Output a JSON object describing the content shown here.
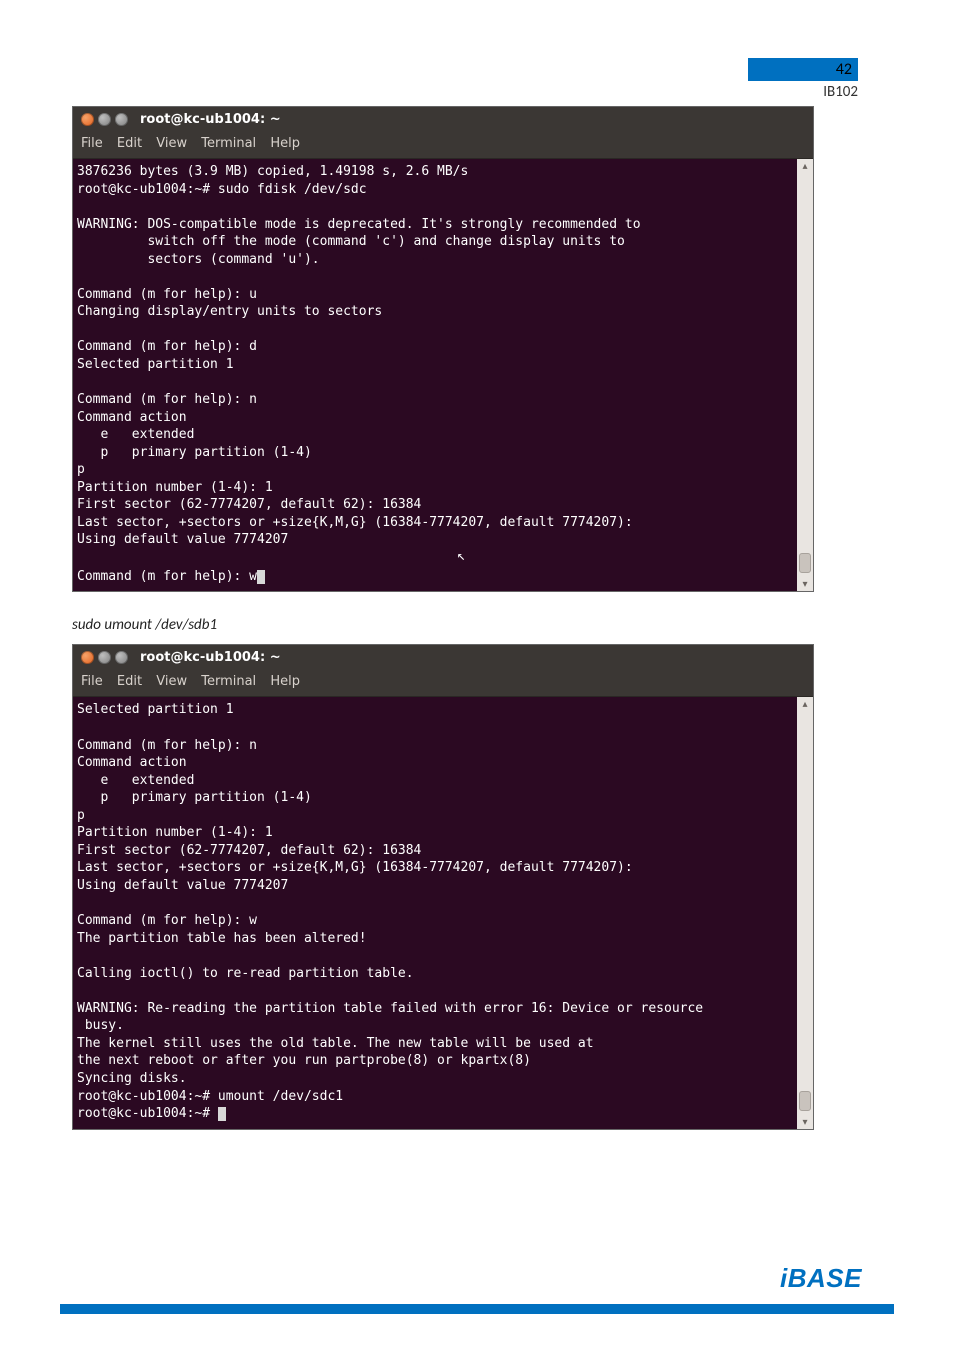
{
  "header": {
    "page_number": "42",
    "model": "IB102"
  },
  "terminal1": {
    "title": "root@kc-ub1004: ~",
    "menu": [
      "File",
      "Edit",
      "View",
      "Terminal",
      "Help"
    ],
    "lines_pre": "3876236 bytes (3.9 MB) copied, 1.49198 s, 2.6 MB/s\nroot@kc-ub1004:~# sudo fdisk /dev/sdc\n\nWARNING: DOS-compatible mode is deprecated. It's strongly recommended to\n         switch off the mode (command 'c') and change display units to\n         sectors (command 'u').\n\nCommand (m for help): u\nChanging display/entry units to sectors\n\nCommand (m for help): d\nSelected partition 1\n\nCommand (m for help): n\nCommand action\n   e   extended\n   p   primary partition (1-4)\np\nPartition number (1-4): 1\nFirst sector (62-7774207, default 62): 16384\nLast sector, +sectors or +size{K,M,G} (16384-7774207, default 7774207):\nUsing default value 7774207",
    "last_line": "Command (m for help): w"
  },
  "caption": "sudo umount /dev/sdb1",
  "terminal2": {
    "title": "root@kc-ub1004: ~",
    "menu": [
      "File",
      "Edit",
      "View",
      "Terminal",
      "Help"
    ],
    "lines_pre": "Selected partition 1\n\nCommand (m for help): n\nCommand action\n   e   extended\n   p   primary partition (1-4)\np\nPartition number (1-4): 1\nFirst sector (62-7774207, default 62): 16384\nLast sector, +sectors or +size{K,M,G} (16384-7774207, default 7774207):\nUsing default value 7774207\n\nCommand (m for help): w\nThe partition table has been altered!\n\nCalling ioctl() to re-read partition table.\n\nWARNING: Re-reading the partition table failed with error 16: Device or resource\n busy.\nThe kernel still uses the old table. The new table will be used at\nthe next reboot or after you run partprobe(8) or kpartx(8)\nSyncing disks.\nroot@kc-ub1004:~# umount /dev/sdc1",
    "last_line": "root@kc-ub1004:~# "
  },
  "footer": {
    "logo": "iBASE"
  }
}
